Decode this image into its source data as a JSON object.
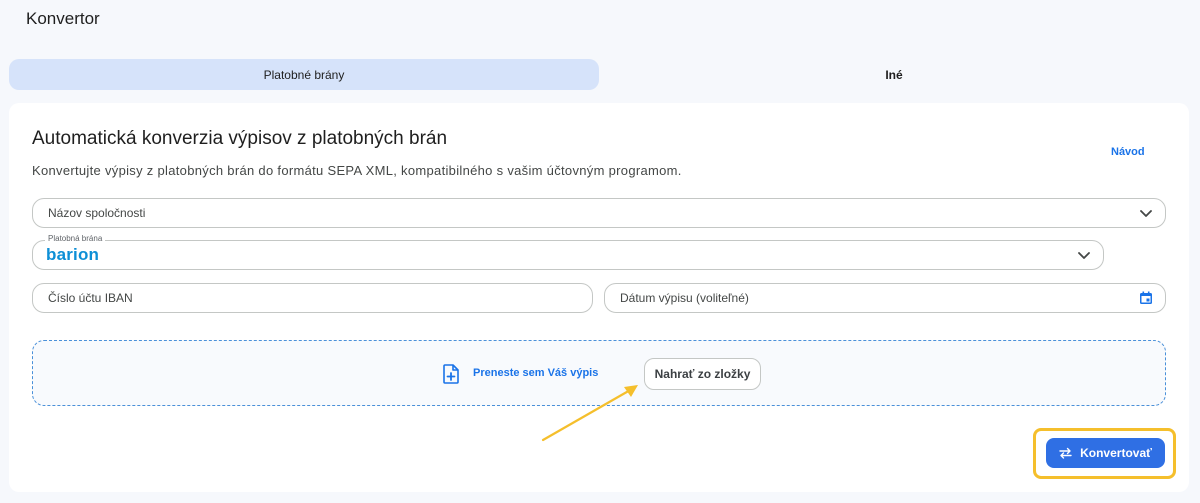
{
  "page": {
    "title": "Konvertor"
  },
  "tabs": [
    {
      "label": "Platobné brány",
      "active": true
    },
    {
      "label": "Iné",
      "active": false
    }
  ],
  "card": {
    "title": "Automatická konverzia výpisov z platobných brán",
    "description": "Konvertujte výpisy z platobných brán do formátu SEPA XML, kompatibilného s vašim účtovným programom."
  },
  "form": {
    "company": {
      "placeholder": "Názov spoločnosti"
    },
    "gateway": {
      "label": "Platobná brána",
      "value_logo_text": "barion"
    },
    "guide_link": "Návod",
    "iban": {
      "placeholder": "Číslo účtu IBAN"
    },
    "date": {
      "placeholder": "Dátum výpisu (voliteľné)"
    }
  },
  "dropzone": {
    "text": "Preneste sem Váš výpis",
    "upload_button": "Nahrať zo zložky"
  },
  "actions": {
    "convert_label": "Konvertovať"
  },
  "colors": {
    "accent": "#1a73e8",
    "primary_button": "#2f6fe4",
    "tab_active_bg": "#d6e3fa",
    "highlight": "#f5bf2c",
    "barion": "#0d8fd6"
  },
  "icons": {
    "company_chevron": "chevron-down-icon",
    "gateway_chevron": "chevron-down-icon",
    "date": "calendar-icon",
    "file_add": "file-add-icon",
    "convert": "swap-arrows-icon"
  }
}
